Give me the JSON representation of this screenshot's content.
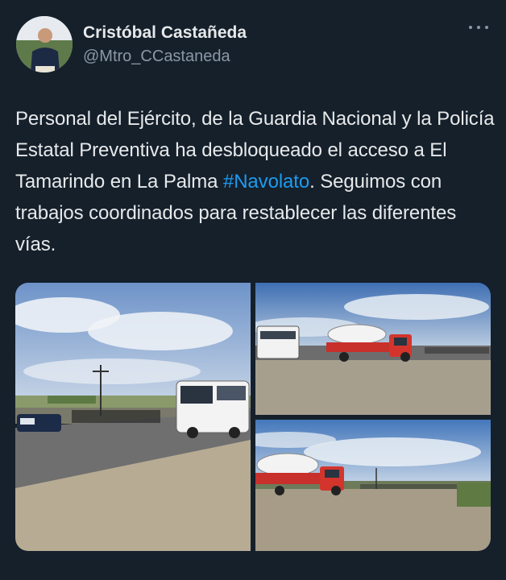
{
  "author": {
    "display_name": "Cristóbal Castañeda",
    "handle": "@Mtro_CCastaneda"
  },
  "tweet": {
    "text_before": "Personal del Ejército, de la Guardia Nacional y la Policía Estatal Preventiva ha desbloqueado el acceso a El Tamarindo en La Palma ",
    "hashtag": "#Navolato",
    "text_after": ". Seguimos con trabajos coordinados para restablecer las diferentes vías."
  },
  "colors": {
    "background": "#15202b",
    "text": "#e7e9ea",
    "secondary_text": "#8b98a5",
    "hashtag": "#1d9bf0"
  },
  "icons": {
    "more": "more-horizontal-icon"
  },
  "media": {
    "count": 3,
    "photos": [
      {
        "scene": "bus-and-police-on-road"
      },
      {
        "scene": "gas-tanker-truck-on-road"
      },
      {
        "scene": "gas-tanker-truck-field"
      }
    ]
  }
}
